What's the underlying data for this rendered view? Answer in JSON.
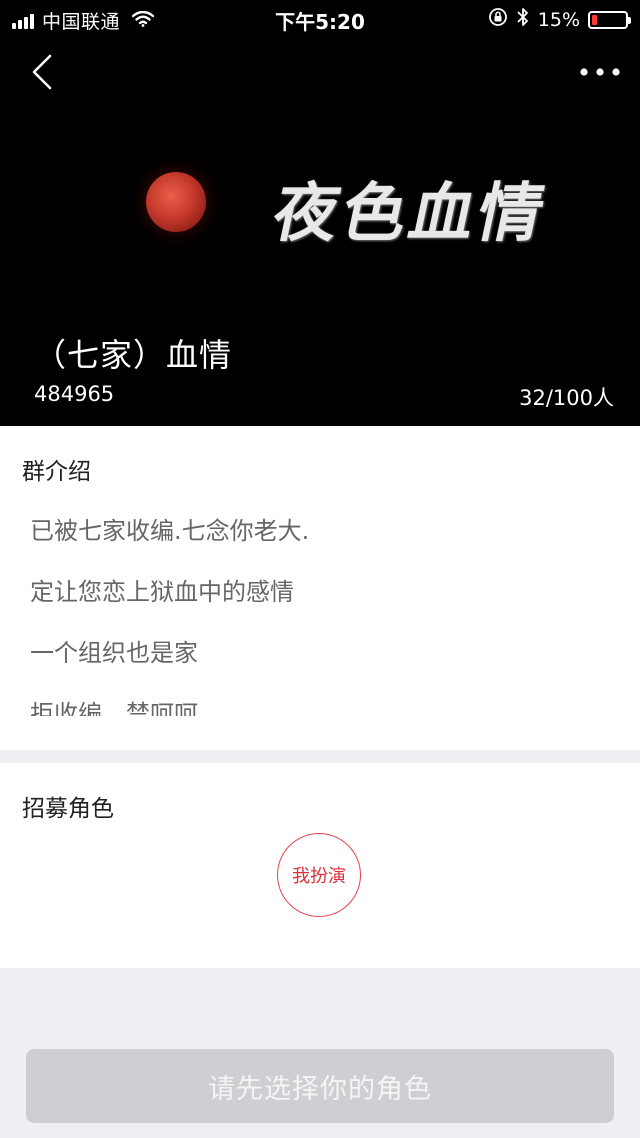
{
  "status_bar": {
    "carrier": "中国联通",
    "time": "下午5:20",
    "battery_percent": "15%",
    "battery_level": 0.15,
    "battery_color": "#ff3b30"
  },
  "nav": {
    "back_icon": "chevron-left-icon",
    "more_icon": "more-dots-icon"
  },
  "banner": {
    "calligraphy_text": "夜色血情"
  },
  "group": {
    "name": "（七家）血情",
    "id": "484965",
    "member_count": "32/100人"
  },
  "intro": {
    "title": "群介绍",
    "lines": [
      "已被七家收编.七念你老大.",
      "定让您恋上狱血中的感情",
      "一个组织也是家",
      "拒收编，禁呵呵"
    ]
  },
  "roles": {
    "title": "招募角色",
    "role_button_label": "我扮演",
    "accent_color": "#e0454d"
  },
  "footer": {
    "select_role_label": "请先选择你的角色"
  }
}
